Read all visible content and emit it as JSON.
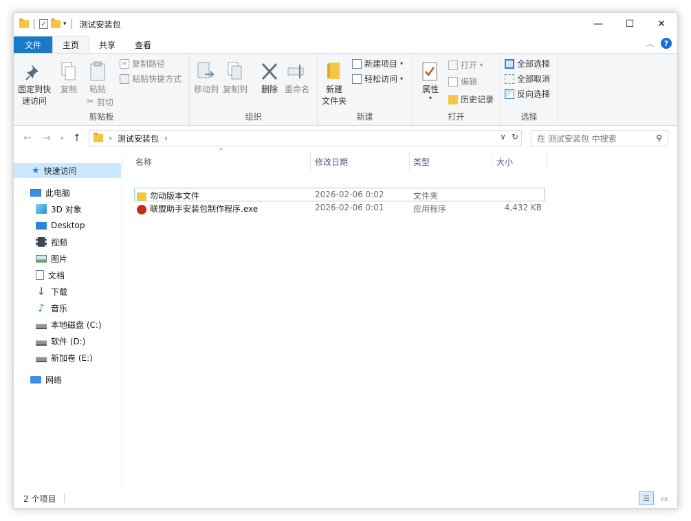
{
  "window": {
    "title": "测试安装包"
  },
  "ribbon_tabs": {
    "file": "文件",
    "home": "主页",
    "share": "共享",
    "view": "查看"
  },
  "clipboard": {
    "pin_line1": "固定到快",
    "pin_line2": "速访问",
    "copy": "复制",
    "paste": "粘贴",
    "copy_path": "复制路径",
    "paste_shortcut": "粘贴快捷方式",
    "cut": "剪切",
    "label": "剪贴板"
  },
  "organize": {
    "move_to": "移动到",
    "copy_to": "复制到",
    "delete": "删除",
    "rename": "重命名",
    "label": "组织"
  },
  "new_group": {
    "new_folder_line1": "新建",
    "new_folder_line2": "文件夹",
    "new_item": "新建项目",
    "easy_access": "轻松访问",
    "label": "新建"
  },
  "open_group": {
    "properties": "属性",
    "open": "打开",
    "edit": "编辑",
    "history": "历史记录",
    "label": "打开"
  },
  "select_group": {
    "select_all": "全部选择",
    "select_none": "全部取消",
    "invert": "反向选择",
    "label": "选择"
  },
  "address": {
    "path": "测试安装包",
    "search_placeholder": "在 测试安装包 中搜索"
  },
  "nav": {
    "quick_access": "快速访问",
    "this_pc": "此电脑",
    "objects3d": "3D 对象",
    "desktop": "Desktop",
    "videos": "视频",
    "pictures": "图片",
    "documents": "文档",
    "downloads": "下载",
    "music": "音乐",
    "drive_c": "本地磁盘 (C:)",
    "drive_d": "软件 (D:)",
    "drive_e": "新加卷 (E:)",
    "network": "网络"
  },
  "columns": {
    "name": "名称",
    "modified": "修改日期",
    "type": "类型",
    "size": "大小"
  },
  "files": [
    {
      "name": "勿动版本文件",
      "modified": "2026-02-06 0:02",
      "type": "文件夹",
      "size": ""
    },
    {
      "name": "联盟助手安装包制作程序.exe",
      "modified": "2026-02-06 0:01",
      "type": "应用程序",
      "size": "4,432 KB"
    }
  ],
  "status": {
    "count": "2 个项目"
  },
  "colors": {
    "accent": "#1979ca",
    "selection": "#cce8ff",
    "folder": "#f6c543"
  }
}
